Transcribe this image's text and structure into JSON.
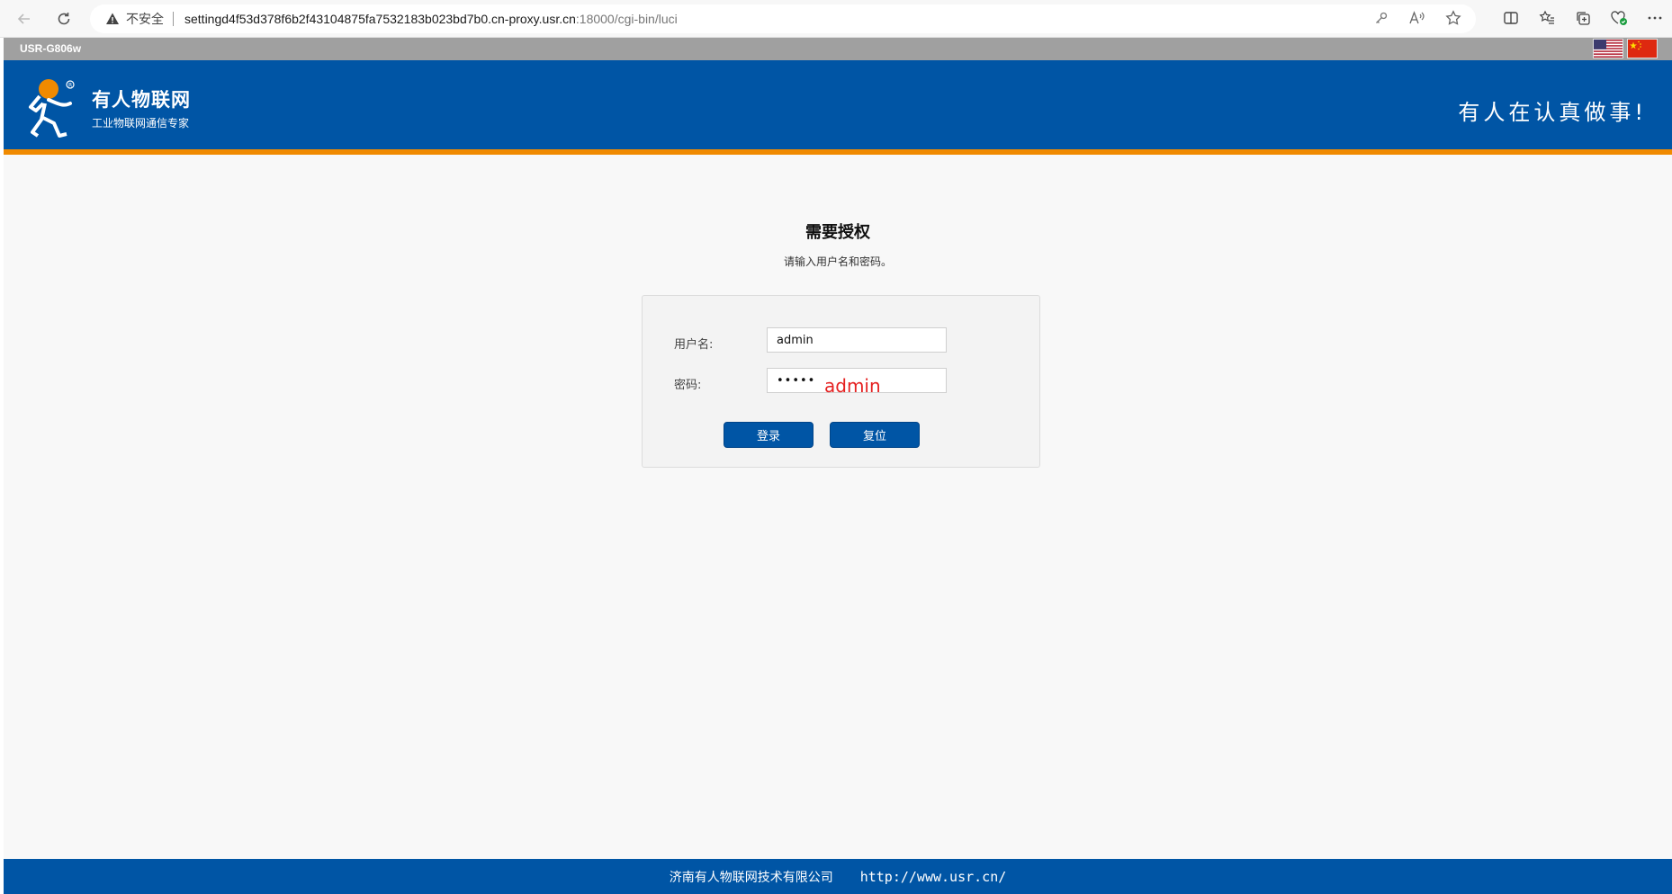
{
  "browser": {
    "security_label": "不安全",
    "url_host": "settingd4f53d378f6b2f43104875fa7532183b023bd7b0.cn-proxy.usr.cn",
    "url_rest": ":18000/cgi-bin/luci",
    "icons": [
      "back-icon",
      "reload-icon",
      "warning-icon",
      "key-icon",
      "read-aloud-icon",
      "favorite-star-icon",
      "split-screen-icon",
      "favorites-list-icon",
      "collections-icon",
      "browser-essentials-icon",
      "more-icon"
    ]
  },
  "header": {
    "model": "USR-G806w",
    "brand_name": "有人物联网",
    "brand_sub": "工业物联网通信专家",
    "slogan": "有人在认真做事!",
    "languages": [
      "english-flag",
      "chinese-flag"
    ]
  },
  "auth": {
    "title": "需要授权",
    "description": "请输入用户名和密码。",
    "username_label": "用户名:",
    "username_value": "admin",
    "password_label": "密码:",
    "password_masked": "•••••",
    "password_hint": "admin",
    "login_label": "登录",
    "reset_label": "复位"
  },
  "footer": {
    "company": "济南有人物联网技术有限公司",
    "url": "http://www.usr.cn/"
  },
  "colors": {
    "brand_blue": "#0055a5",
    "accent_orange": "#f08a00",
    "hint_red": "#e52020"
  }
}
